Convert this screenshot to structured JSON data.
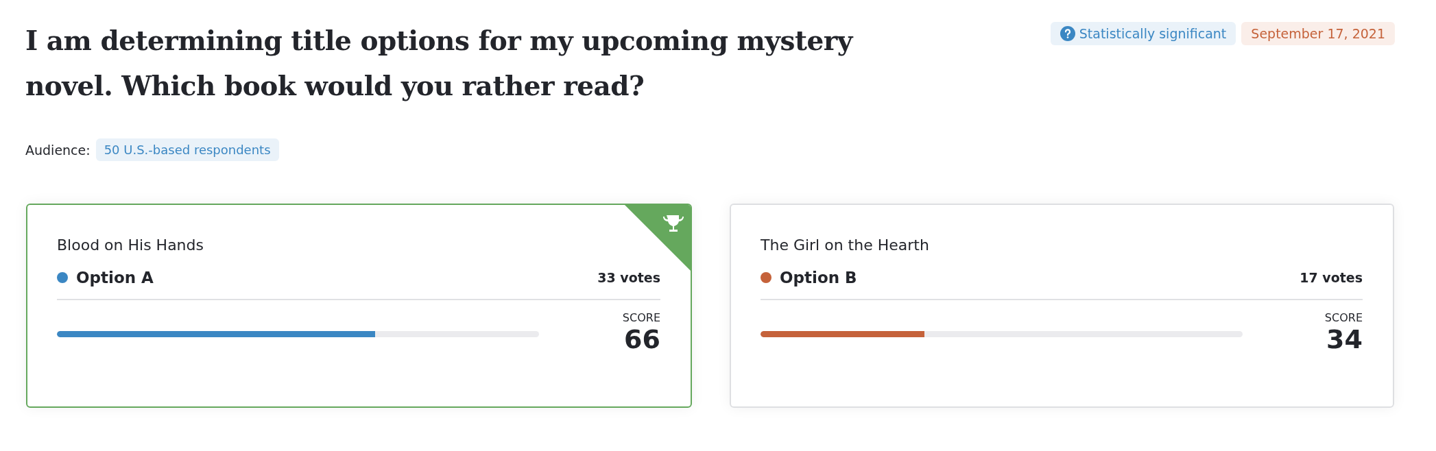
{
  "question": "I am determining title options for my upcoming mystery novel. Which book would you rather read?",
  "badges": [
    {
      "kind": "significance",
      "label": "Statistically significant"
    },
    {
      "kind": "date",
      "label": "September 17, 2021"
    }
  ],
  "audience": {
    "label": "Audience:",
    "value": "50 U.S.-based respondents"
  },
  "options": [
    {
      "title": "Blood on His Hands",
      "name": "Option A",
      "color": "#3b87c3",
      "votes": "33 votes",
      "score_label": "SCORE",
      "score": "66",
      "level": 0.66,
      "winner": true
    },
    {
      "title": "The Girl on the Hearth",
      "name": "Option B",
      "color": "#c5623a",
      "votes": "17 votes",
      "score_label": "SCORE",
      "score": "34",
      "level": 0.34,
      "winner": false
    }
  ]
}
